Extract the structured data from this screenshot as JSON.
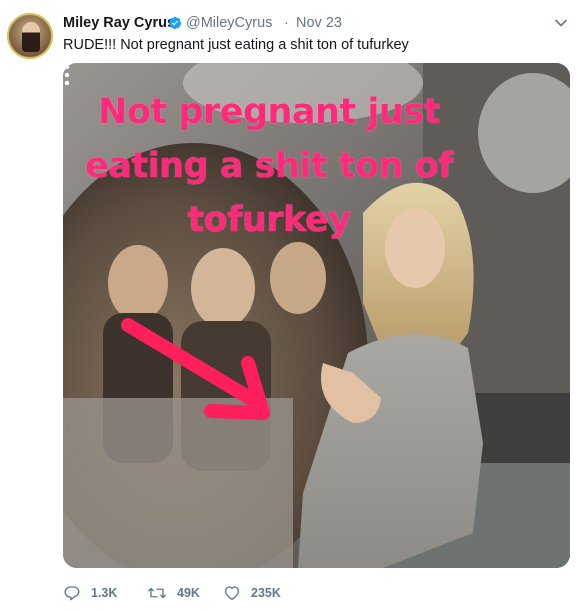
{
  "tweet": {
    "user": {
      "name": "Miley Ray Cyrus",
      "handle": "@MileyCyrus",
      "separator": "·",
      "date": "Nov 23",
      "avatar_icon": "profile-photo"
    },
    "text": "RUDE!!! Not pregnant just eating a shit ton of tufurkey",
    "media": {
      "overlay_lines": [
        "Not pregnant just",
        "eating a shit ton of",
        "tofurkey"
      ],
      "overlay_color": "#ff2a7a",
      "arrow_color": "#ff1f5a"
    },
    "actions": {
      "replies": "1.3K",
      "retweets": "49K",
      "likes": "235K"
    },
    "colors": {
      "verified": "#1da1f2",
      "muted": "#657786"
    }
  }
}
